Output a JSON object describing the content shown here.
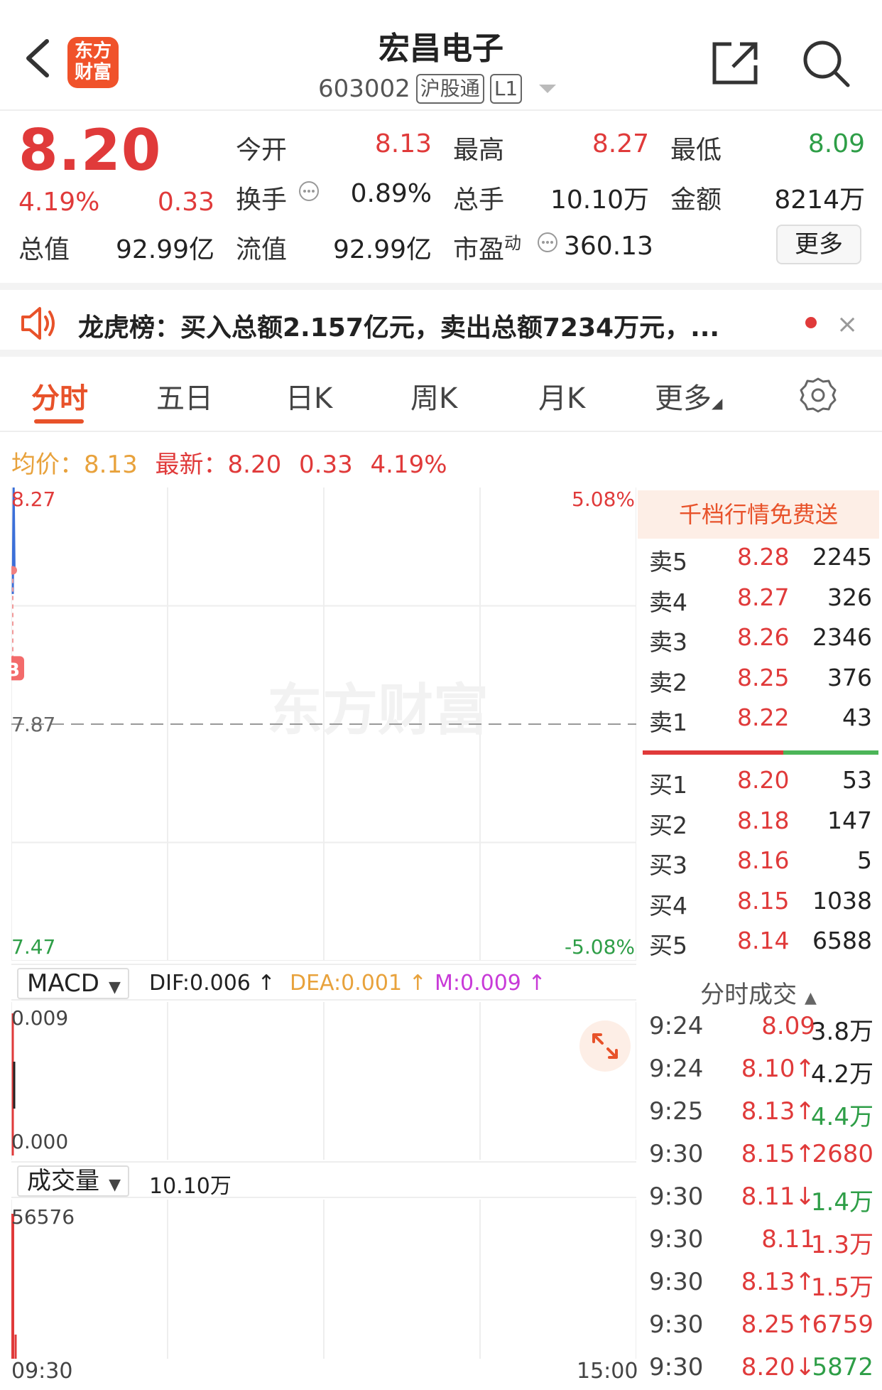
{
  "header": {
    "back_icon": "chevron-left-icon",
    "logo_text": "东方\n财富",
    "stock_name": "宏昌电子",
    "stock_code": "603002",
    "tag1": "沪股通",
    "tag2": "L1",
    "share_icon": "share-icon",
    "search_icon": "search-icon"
  },
  "quote": {
    "price": "8.20",
    "change_pct": "4.19%",
    "change": "0.33",
    "open_label": "今开",
    "open": "8.13",
    "high_label": "最高",
    "high": "8.27",
    "low_label": "最低",
    "low": "8.09",
    "turnover_label": "换手",
    "turnover": "0.89%",
    "volume_label": "总手",
    "volume": "10.10万",
    "amount_label": "金额",
    "amount": "8214万",
    "mcap_label": "总值",
    "mcap": "92.99亿",
    "float_label": "流值",
    "float": "92.99亿",
    "pe_label": "市盈",
    "pe_sup": "动",
    "pe": "360.13",
    "more_label": "更多",
    "colors": {
      "up": "#e03a3a",
      "down": "#2e9e47",
      "accent": "#e8522a"
    }
  },
  "notice": {
    "text": "龙虎榜：买入总额2.157亿元，卖出总额7234万元，...",
    "icon": "speaker-icon",
    "close": "×"
  },
  "tabs": [
    "分时",
    "五日",
    "日K",
    "周K",
    "月K",
    "更多"
  ],
  "summary": {
    "avg_label": "均价：",
    "avg": "8.13",
    "last_label": "最新：",
    "last": "8.20",
    "chg": "0.33",
    "pct": "4.19%"
  },
  "chart_data": {
    "type": "line",
    "title": "",
    "xlabel": "",
    "ylabel": "",
    "y_top": "8.27",
    "y_mid": "7.87",
    "y_bottom": "7.47",
    "pct_top": "5.08%",
    "pct_bottom": "-5.08%",
    "ylim": [
      7.47,
      8.27
    ],
    "prev_close": 7.87,
    "x_start": "09:30",
    "x_end": "15:00",
    "series": [
      {
        "values": [
          8.09,
          8.27,
          8.13
        ]
      }
    ],
    "marker": "B",
    "watermark": "东方财富"
  },
  "macd": {
    "select": "MACD",
    "dif": "DIF:0.006 ↑",
    "dea": "DEA:0.001 ↑",
    "m": "M:0.009 ↑",
    "top": "0.009",
    "bottom": "0.000"
  },
  "vol": {
    "select": "成交量",
    "total": "10.10万",
    "top": "56576"
  },
  "orderbook": {
    "banner": "千档行情免费送",
    "asks": [
      {
        "label": "卖5",
        "price": "8.28",
        "vol": "2245"
      },
      {
        "label": "卖4",
        "price": "8.27",
        "vol": "326"
      },
      {
        "label": "卖3",
        "price": "8.26",
        "vol": "2346"
      },
      {
        "label": "卖2",
        "price": "8.25",
        "vol": "376"
      },
      {
        "label": "卖1",
        "price": "8.22",
        "vol": "43"
      }
    ],
    "bids": [
      {
        "label": "买1",
        "price": "8.20",
        "vol": "53"
      },
      {
        "label": "买2",
        "price": "8.18",
        "vol": "147"
      },
      {
        "label": "买3",
        "price": "8.16",
        "vol": "5"
      },
      {
        "label": "买4",
        "price": "8.15",
        "vol": "1038"
      },
      {
        "label": "买5",
        "price": "8.14",
        "vol": "6588"
      }
    ]
  },
  "trades": {
    "title": "分时成交",
    "rows": [
      {
        "time": "9:24",
        "price": "8.09",
        "vol": "3.8万",
        "pc": "red",
        "vc": "dark"
      },
      {
        "time": "9:24",
        "price": "8.10↑",
        "vol": "4.2万",
        "pc": "red",
        "vc": "dark"
      },
      {
        "time": "9:25",
        "price": "8.13↑",
        "vol": "4.4万",
        "pc": "red",
        "vc": "green"
      },
      {
        "time": "9:30",
        "price": "8.15↑",
        "vol": "2680",
        "pc": "red",
        "vc": "red"
      },
      {
        "time": "9:30",
        "price": "8.11↓",
        "vol": "1.4万",
        "pc": "red",
        "vc": "green"
      },
      {
        "time": "9:30",
        "price": "8.11",
        "vol": "1.3万",
        "pc": "red",
        "vc": "red"
      },
      {
        "time": "9:30",
        "price": "8.13↑",
        "vol": "1.5万",
        "pc": "red",
        "vc": "red"
      },
      {
        "time": "9:30",
        "price": "8.25↑",
        "vol": "6759",
        "pc": "red",
        "vc": "red"
      },
      {
        "time": "9:30",
        "price": "8.20↓",
        "vol": "5872",
        "pc": "red",
        "vc": "green"
      }
    ]
  }
}
